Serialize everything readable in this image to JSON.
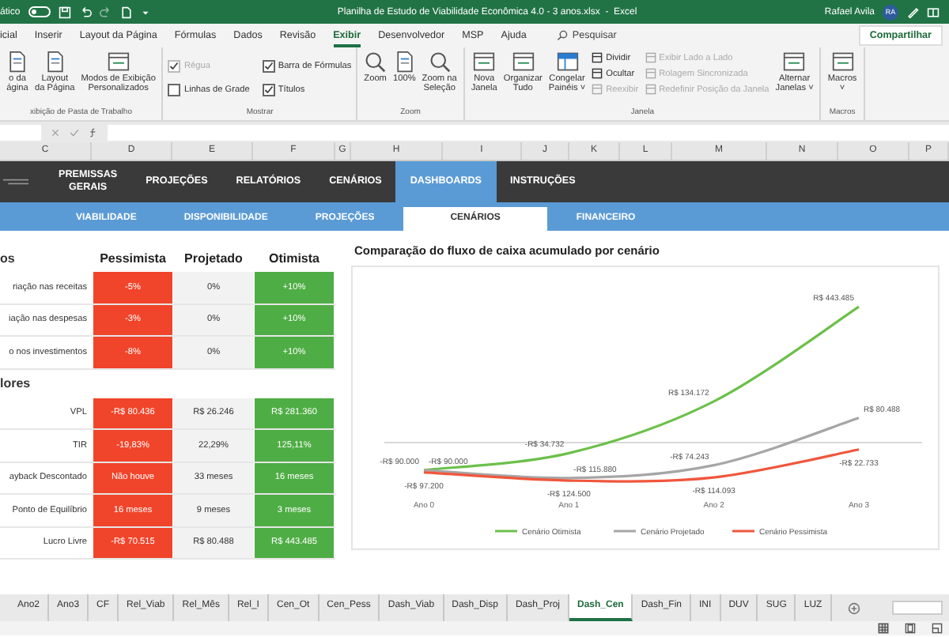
{
  "title_bar": {
    "autosave_label": "ático",
    "autosave_on": false,
    "title": "Planilha de Estudo de Viabilidade Econômica 4.0 - 3 anos.xlsx  -  Excel",
    "user": "Rafael Avila",
    "avatar": "RA"
  },
  "ribbon_tabs": [
    {
      "label": "icial",
      "selected": false
    },
    {
      "label": "Inserir",
      "selected": false
    },
    {
      "label": "Layout da Página",
      "selected": false
    },
    {
      "label": "Fórmulas",
      "selected": false
    },
    {
      "label": "Dados",
      "selected": false
    },
    {
      "label": "Revisão",
      "selected": false
    },
    {
      "label": "Exibir",
      "selected": true
    },
    {
      "label": "Desenvolvedor",
      "selected": false
    },
    {
      "label": "MSP",
      "selected": false
    },
    {
      "label": "Ajuda",
      "selected": false
    }
  ],
  "search": {
    "placeholder": "Pesquisar"
  },
  "share_button": "Compartilhar",
  "ribbon_groups": [
    {
      "label": "xibição de Pasta de Trabalho",
      "items": [
        {
          "kind": "big",
          "label": "o da\nágina"
        },
        {
          "kind": "big",
          "label": "Layout\nda Página"
        },
        {
          "kind": "big",
          "label": "Modos de Exibição\nPersonalizados"
        }
      ]
    },
    {
      "label": "Mostrar",
      "items": [
        {
          "kind": "checks",
          "items": [
            {
              "label": "Régua",
              "checked": true,
              "disabled": true
            },
            {
              "label": "Linhas de Grade",
              "checked": false,
              "disabled": false
            },
            {
              "label": "Barra de Fórmulas",
              "checked": true,
              "disabled": false
            },
            {
              "label": "Títulos",
              "checked": true,
              "disabled": false
            }
          ]
        }
      ]
    },
    {
      "label": "Zoom",
      "items": [
        {
          "kind": "big",
          "label": "Zoom"
        },
        {
          "kind": "big",
          "label": "100%"
        },
        {
          "kind": "big",
          "label": "Zoom na\nSeleção"
        }
      ]
    },
    {
      "label": "Janela",
      "items": [
        {
          "kind": "big",
          "label": "Nova\nJanela"
        },
        {
          "kind": "big",
          "label": "Organizar\nTudo"
        },
        {
          "kind": "big",
          "label": "Congelar\nPainéis ˅"
        },
        {
          "kind": "stack",
          "items": [
            {
              "label": "Dividir",
              "disabled": false
            },
            {
              "label": "Ocultar",
              "disabled": false
            },
            {
              "label": "Reexibir",
              "disabled": true
            }
          ]
        },
        {
          "kind": "stack",
          "items": [
            {
              "label": "Exibir Lado a Lado",
              "disabled": true
            },
            {
              "label": "Rolagem Sincronizada",
              "disabled": true
            },
            {
              "label": "Redefinir Posição da Janela",
              "disabled": true
            }
          ]
        },
        {
          "kind": "big",
          "label": "Alternar\nJanelas ˅"
        }
      ]
    },
    {
      "label": "Macros",
      "items": [
        {
          "kind": "big",
          "label": "Macros\n˅"
        }
      ]
    }
  ],
  "column_headers": [
    "C",
    "D",
    "E",
    "F",
    "G",
    "H",
    "I",
    "J",
    "K",
    "L",
    "M",
    "N",
    "O",
    "P"
  ],
  "nav_tabs": [
    {
      "label": "PREMISSAS\nGERAIS",
      "selected": false
    },
    {
      "label": "PROJEÇÕES",
      "selected": false
    },
    {
      "label": "RELATÓRIOS",
      "selected": false
    },
    {
      "label": "CENÁRIOS",
      "selected": false
    },
    {
      "label": "DASHBOARDS",
      "selected": true
    },
    {
      "label": "INSTRUÇÕES",
      "selected": false
    }
  ],
  "sub_tabs": [
    {
      "label": "VIABILIDADE",
      "selected": false
    },
    {
      "label": "DISPONIBILIDADE",
      "selected": false
    },
    {
      "label": "PROJEÇÕES",
      "selected": false
    },
    {
      "label": "CENÁRIOS",
      "selected": true
    },
    {
      "label": "FINANCEIRO",
      "selected": false
    }
  ],
  "scenario_columns": [
    {
      "name": "Pessimista",
      "color": "#f0452b"
    },
    {
      "name": "Projetado",
      "color": "#f2f2f2"
    },
    {
      "name": "Otimista",
      "color": "#4fad45"
    }
  ],
  "sections": [
    {
      "title": "os",
      "rows": [
        {
          "label": "riação nas receitas",
          "values": [
            "-5%",
            "0%",
            "+10%"
          ]
        },
        {
          "label": "iação nas despesas",
          "values": [
            "-3%",
            "0%",
            "+10%"
          ]
        },
        {
          "label": "o nos investimentos",
          "values": [
            "-8%",
            "0%",
            "+10%"
          ]
        }
      ]
    },
    {
      "title": "lores",
      "rows": [
        {
          "label": "VPL",
          "values": [
            "-R$ 80.436",
            "R$ 26.246",
            "R$ 281.360"
          ]
        },
        {
          "label": "TIR",
          "values": [
            "-19,83%",
            "22,29%",
            "125,11%"
          ]
        },
        {
          "label": "ayback Descontado",
          "values": [
            "Não houve",
            "33 meses",
            "16 meses"
          ]
        },
        {
          "label": "Ponto de Equilíbrio",
          "values": [
            "16 meses",
            "9 meses",
            "3 meses"
          ]
        },
        {
          "label": "Lucro Livre",
          "values": [
            "-R$ 70.515",
            "R$ 80.488",
            "R$ 443.485"
          ]
        }
      ]
    }
  ],
  "chart_data": {
    "type": "line",
    "title": "Comparação do fluxo de caixa acumulado por cenário",
    "categories": [
      "Ano 0",
      "Ano 1",
      "Ano 2",
      "Ano 3"
    ],
    "legend": "bottom",
    "series": [
      {
        "name": "Cenário Otimista",
        "color": "#6cc04a",
        "values": [
          -90000,
          -34732,
          134172,
          443485
        ],
        "value_labels": [
          "-R$ 90.000",
          "-R$ 34.732",
          "R$ 134.172",
          "R$ 443.485"
        ]
      },
      {
        "name": "Cenário Projetado",
        "color": "#a6a6a6",
        "values": [
          -90000,
          -115880,
          -74243,
          80488
        ],
        "value_labels": [
          "-R$ 90.000",
          "-R$ 115.880",
          "-R$ 74.243",
          "R$ 80.488"
        ]
      },
      {
        "name": "Cenário Pessimista",
        "color": "#f0563c",
        "values": [
          -97200,
          -124500,
          -114093,
          -22733
        ],
        "value_labels": [
          "-R$ 97.200",
          "-R$ 124.500",
          "-R$ 114.093",
          "-R$ 22.733"
        ]
      }
    ]
  },
  "sheet_tabs": [
    {
      "label": "Ano2",
      "selected": false
    },
    {
      "label": "Ano3",
      "selected": false
    },
    {
      "label": "CF",
      "selected": false
    },
    {
      "label": "Rel_Viab",
      "selected": false
    },
    {
      "label": "Rel_Mês",
      "selected": false
    },
    {
      "label": "Rel_I",
      "selected": false
    },
    {
      "label": "Cen_Ot",
      "selected": false
    },
    {
      "label": "Cen_Pess",
      "selected": false
    },
    {
      "label": "Dash_Viab",
      "selected": false
    },
    {
      "label": "Dash_Disp",
      "selected": false
    },
    {
      "label": "Dash_Proj",
      "selected": false
    },
    {
      "label": "Dash_Cen",
      "selected": true
    },
    {
      "label": "Dash_Fin",
      "selected": false
    },
    {
      "label": "INI",
      "selected": false
    },
    {
      "label": "DUV",
      "selected": false
    },
    {
      "label": "SUG",
      "selected": false
    },
    {
      "label": "LUZ",
      "selected": false
    }
  ]
}
